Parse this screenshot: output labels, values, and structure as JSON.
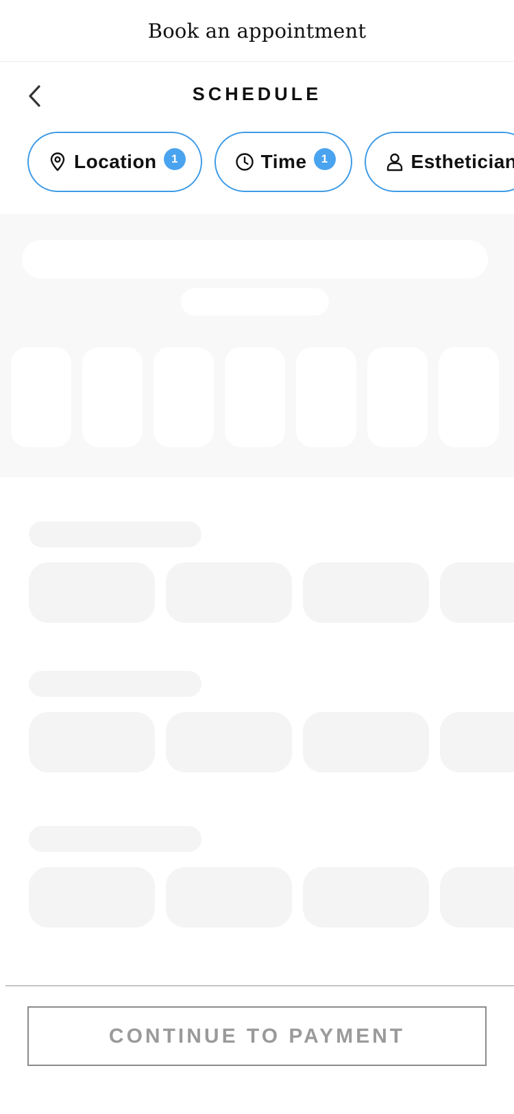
{
  "app": {
    "title": "Book an appointment"
  },
  "header": {
    "back_icon": "chevron-left-icon",
    "section_title": "SCHEDULE"
  },
  "filters": [
    {
      "icon": "location-pin-icon",
      "label": "Location",
      "badge": "1"
    },
    {
      "icon": "clock-icon",
      "label": "Time",
      "badge": "1"
    },
    {
      "icon": "person-icon",
      "label": "Esthetician",
      "badge": ""
    }
  ],
  "colors": {
    "accent": "#3f9be6",
    "badge": "#4aa3ef",
    "skeleton": "#f4f4f4",
    "calendar_bg": "#f8f8f8",
    "disabled_text": "#9a9a9a"
  },
  "footer": {
    "continue_label": "CONTINUE TO PAYMENT",
    "continue_enabled": false
  }
}
